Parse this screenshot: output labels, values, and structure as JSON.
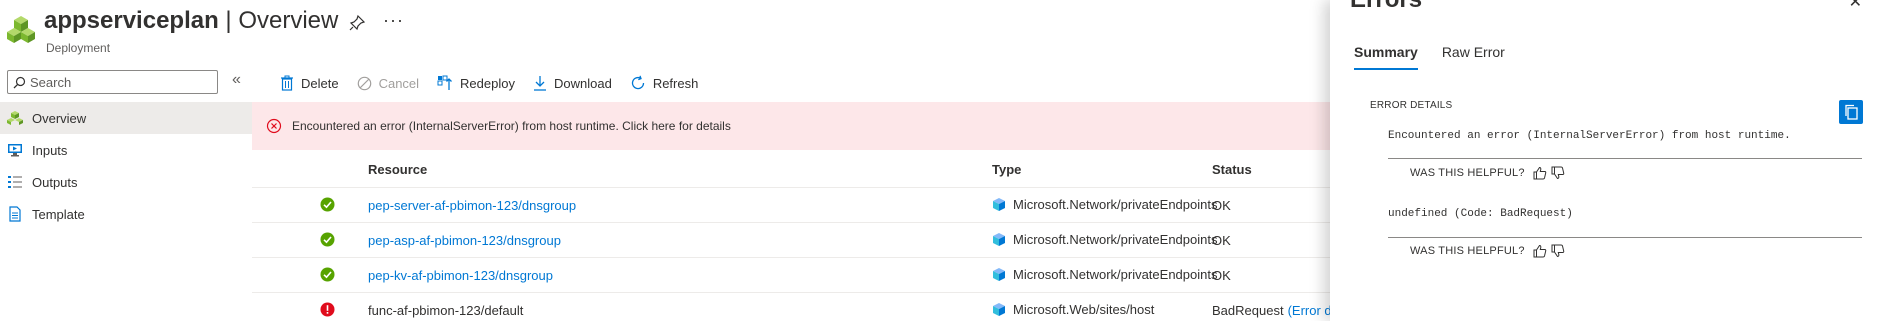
{
  "header": {
    "resource_name": "appserviceplan",
    "separator": "|",
    "view": "Overview",
    "subtitle": "Deployment"
  },
  "search": {
    "placeholder": "Search"
  },
  "sidebar": {
    "items": [
      {
        "label": "Overview",
        "icon": "overview-icon"
      },
      {
        "label": "Inputs",
        "icon": "inputs-icon"
      },
      {
        "label": "Outputs",
        "icon": "outputs-icon"
      },
      {
        "label": "Template",
        "icon": "template-icon"
      }
    ]
  },
  "toolbar": {
    "delete_label": "Delete",
    "cancel_label": "Cancel",
    "redeploy_label": "Redeploy",
    "download_label": "Download",
    "refresh_label": "Refresh"
  },
  "banner": {
    "text": "Encountered an error (InternalServerError) from host runtime. Click here for details"
  },
  "table": {
    "columns": {
      "resource": "Resource",
      "type": "Type",
      "status": "Status"
    },
    "rows": [
      {
        "status_icon": "success-icon",
        "resource": "pep-server-af-pbimon-123/dnsgroup",
        "type": "Microsoft.Network/privateEndpoints",
        "status": "OK",
        "status_extra": ""
      },
      {
        "status_icon": "success-icon",
        "resource": "pep-asp-af-pbimon-123/dnsgroup",
        "type": "Microsoft.Network/privateEndpoints",
        "status": "OK",
        "status_extra": ""
      },
      {
        "status_icon": "success-icon",
        "resource": "pep-kv-af-pbimon-123/dnsgroup",
        "type": "Microsoft.Network/privateEndpoints",
        "status": "OK",
        "status_extra": ""
      },
      {
        "status_icon": "error-icon",
        "resource": "func-af-pbimon-123/default",
        "type": "Microsoft.Web/sites/host",
        "status": "BadRequest",
        "status_extra": "(Error d"
      }
    ]
  },
  "panel": {
    "title": "Errors",
    "tabs": [
      {
        "label": "Summary"
      },
      {
        "label": "Raw Error"
      }
    ],
    "details_label": "ERROR DETAILS",
    "messages": [
      {
        "text": "Encountered an error (InternalServerError) from host runtime.",
        "helpful": "WAS THIS HELPFUL?"
      },
      {
        "text": "undefined (Code: BadRequest)",
        "helpful": "WAS THIS HELPFUL?"
      }
    ]
  },
  "colors": {
    "accent": "#0078d4",
    "success": "#57a300",
    "error": "#e00b1c",
    "banner_bg": "#fde7e9"
  }
}
